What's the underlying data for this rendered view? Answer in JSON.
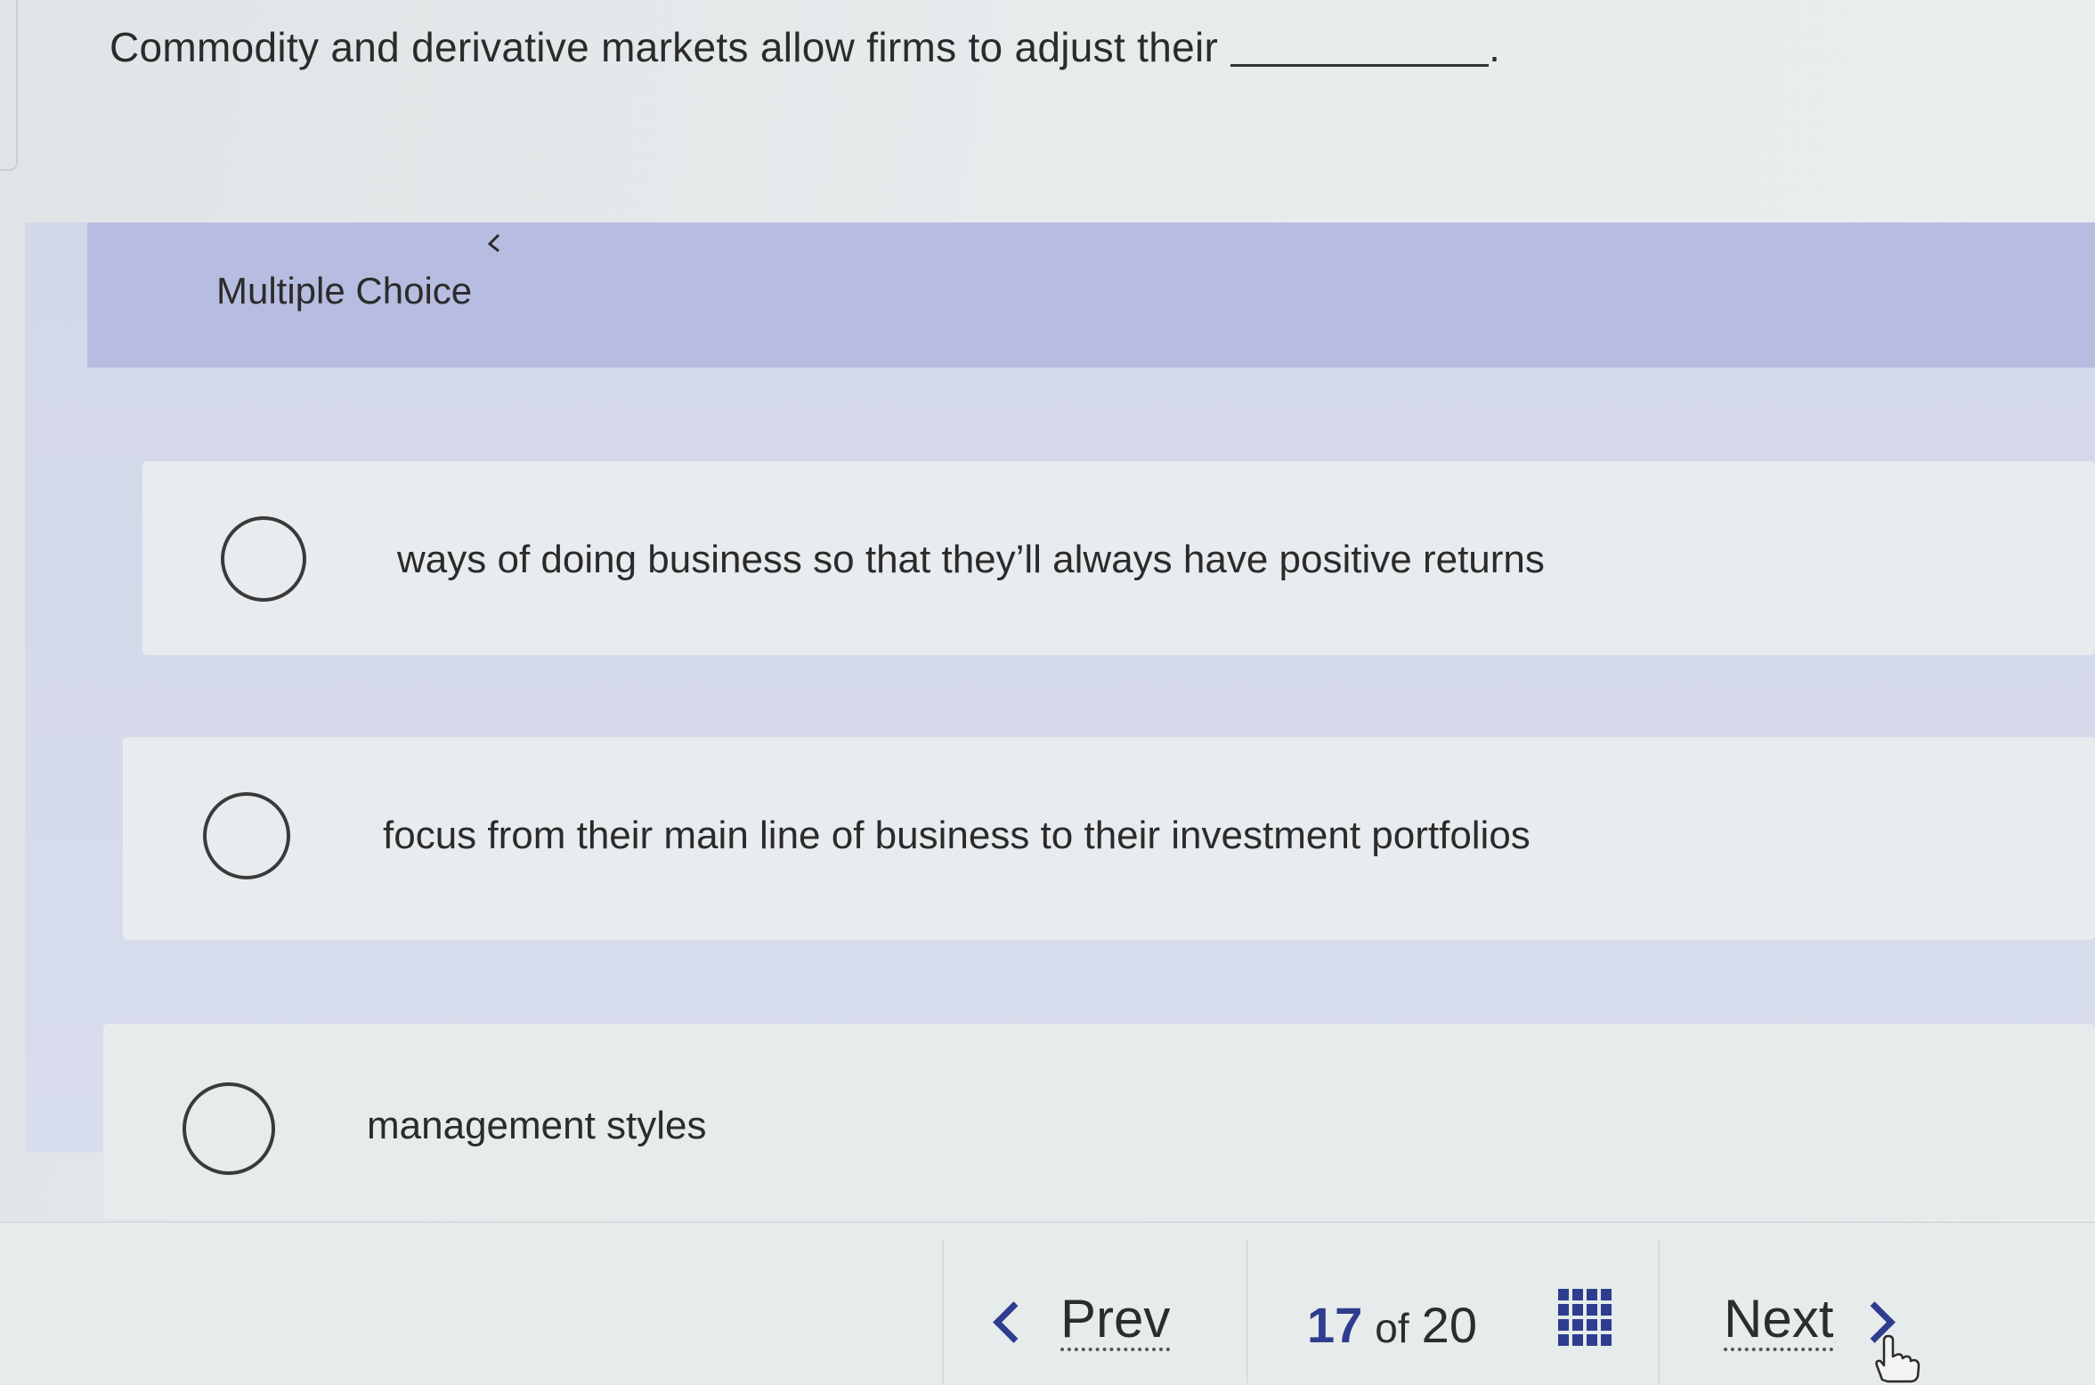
{
  "question": {
    "text": "Commodity and derivative markets allow firms to adjust their",
    "suffix": "."
  },
  "section": {
    "label": "Multiple Choice"
  },
  "options": [
    {
      "label": "ways of doing business so that they’ll always have positive returns",
      "selected": false
    },
    {
      "label": "focus from their main line of business to their investment portfolios",
      "selected": false
    },
    {
      "label": "management styles",
      "selected": false
    }
  ],
  "navigation": {
    "prev_label": "Prev",
    "next_label": "Next",
    "current": "17",
    "of_label": "of",
    "total": "20"
  },
  "icons": {
    "prev": "chevron-left-icon",
    "next": "chevron-right-icon",
    "grid": "question-grid-icon",
    "cursor": "hand-pointer-icon"
  },
  "colors": {
    "accent": "#2f3d8f",
    "header": "#b7bde0",
    "panel": "#d4d9eb"
  }
}
